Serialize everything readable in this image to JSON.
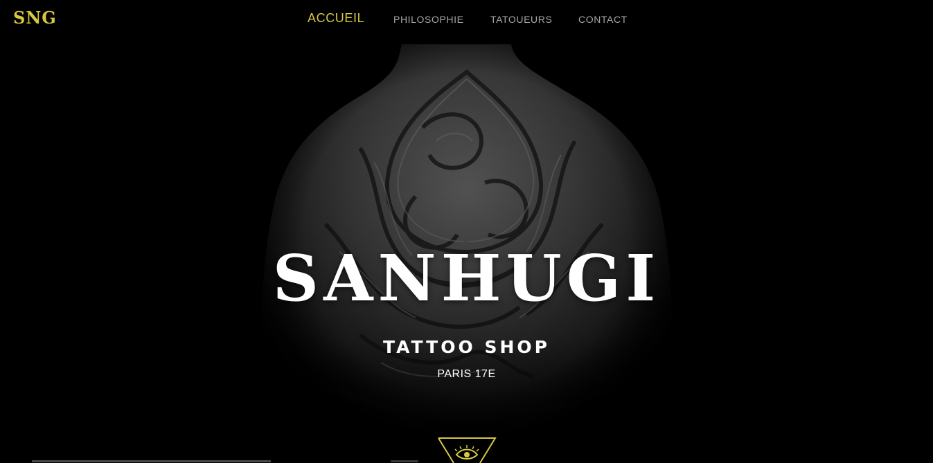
{
  "header": {
    "logo": "SNG",
    "nav": [
      {
        "label": "ACCUEIL",
        "active": true
      },
      {
        "label": "PHILOSOPHIE",
        "active": false
      },
      {
        "label": "TATOUEURS",
        "active": false
      },
      {
        "label": "CONTACT",
        "active": false
      }
    ]
  },
  "hero": {
    "title": "SANHUGI",
    "subtitle": "TATTOO SHOP",
    "location": "PARIS 17E",
    "background_image": "back-tattoo-phoenix",
    "badge_icon": "eye-triangle-icon"
  },
  "colors": {
    "accent": "#d8c840",
    "background": "#000000",
    "nav_inactive": "#a7a7a7",
    "text": "#ffffff"
  }
}
